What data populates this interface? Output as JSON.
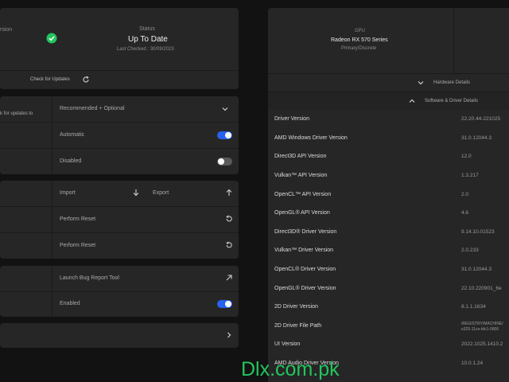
{
  "status_card": {
    "version_label": "rsion",
    "status_label": "Status",
    "status_value": "Up To Date",
    "last_checked": "Last Checked : 30/09/2023",
    "check_updates": "Check for Updates"
  },
  "updates_card": {
    "row1_label": "k for updates to",
    "row1_value": "Recommended + Optional",
    "row2_value": "Automatic",
    "row3_value": "Disabled"
  },
  "profile_card": {
    "import_label": "Import",
    "export_label": "Export",
    "reset1_label": "Perform Reset",
    "reset2_label": "Perform Reset"
  },
  "bug_card": {
    "launch_label": "Launch Bug Report Tool",
    "enabled_label": "Enabled"
  },
  "gpu": {
    "header": "GPU",
    "name": "Radeon RX 570 Series",
    "sub": "Primary/Discrete"
  },
  "sections": {
    "hardware": "Hardware Details",
    "software": "Software & Driver Details"
  },
  "driver_rows": [
    {
      "label": "Driver Version",
      "value": "22.20.44-221025"
    },
    {
      "label": "AMD Windows Driver Version",
      "value": "31.0.12044.3"
    },
    {
      "label": "Direct3D API Version",
      "value": "12.0"
    },
    {
      "label": "Vulkan™ API Version",
      "value": "1.3.217"
    },
    {
      "label": "OpenCL™ API Version",
      "value": "2.0"
    },
    {
      "label": "OpenGL® API Version",
      "value": "4.6"
    },
    {
      "label": "Direct3D® Driver Version",
      "value": "9.14.10.01523"
    },
    {
      "label": "Vulkan™ Driver Version",
      "value": "2.0.233"
    },
    {
      "label": "OpenCL® Driver Version",
      "value": "31.0.12044.3"
    },
    {
      "label": "OpenGL® Driver Version",
      "value": "22.10.220901_6e"
    },
    {
      "label": "2D Driver Version",
      "value": "8.1.1.1634"
    },
    {
      "label": "2D Driver File Path",
      "value": "/REGISTRY/MACHINE/",
      "value2": "e325-11ce-bfc1-0800"
    },
    {
      "label": "UI Version",
      "value": "2022.1025.1410.2"
    },
    {
      "label": "AMD Audio Driver Version",
      "value": "10.0.1.24"
    }
  ],
  "watermark": "Dlx.com.pk",
  "colors": {
    "accent": "#2563eb",
    "ok": "#22c55e",
    "panel": "#262626",
    "bg": "#121212"
  }
}
